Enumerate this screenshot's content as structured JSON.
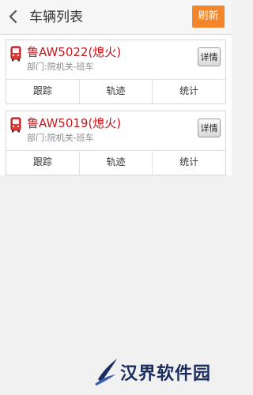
{
  "header": {
    "title": "车辆列表",
    "refresh_label": "刷新",
    "refresh_color": "#f3862a"
  },
  "vehicles": [
    {
      "name": "鲁AW5022(熄火)",
      "dept": "部门:院机关-班车",
      "detail_label": "详情",
      "actions": [
        "跟踪",
        "轨迹",
        "统计"
      ]
    },
    {
      "name": "鲁AW5019(熄火)",
      "dept": "部门:院机关-班车",
      "detail_label": "详情",
      "actions": [
        "跟踪",
        "轨迹",
        "统计"
      ]
    }
  ],
  "icons": {
    "back": "chevron-left-icon",
    "vehicle": "bus-icon"
  },
  "colors": {
    "vehicle_name": "#c4171c",
    "watermark": "#1b2d5e"
  },
  "watermark": {
    "text": "汉界软件园"
  }
}
